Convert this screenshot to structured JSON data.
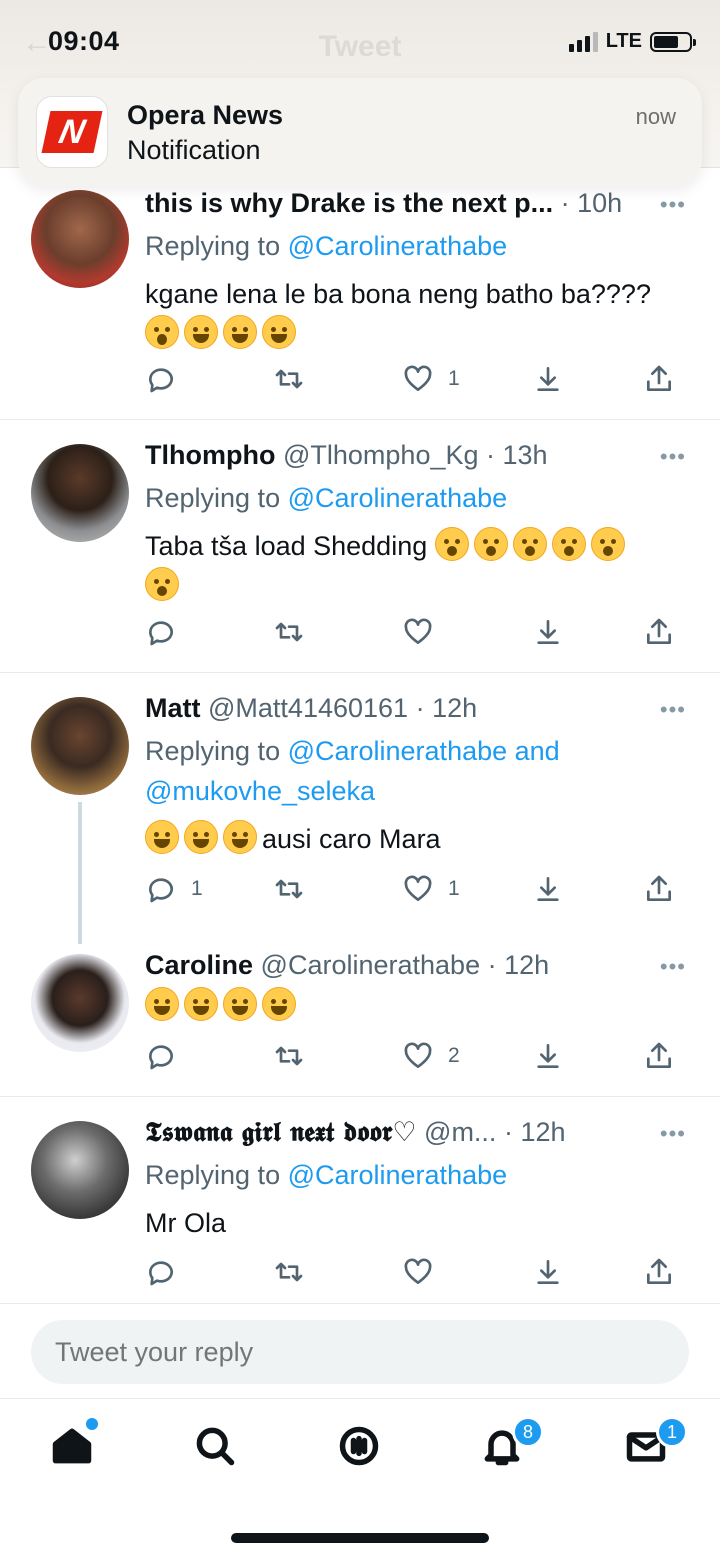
{
  "status_bar": {
    "time": "09:04",
    "network": "LTE"
  },
  "header": {
    "title": "Tweet"
  },
  "notification": {
    "app": "Opera News",
    "body": "Notification",
    "time": "now",
    "logo_letter": "N"
  },
  "tweets": [
    {
      "name": "this is why Drake is the next p...",
      "handle": "",
      "time": "10h",
      "reply_prefix": "Replying to ",
      "mentions": "@Carolinerathabe",
      "text": "kgane lena le ba bona neng batho ba????",
      "emojis": [
        "shock",
        "laugh",
        "laugh",
        "laugh"
      ],
      "replies": "",
      "likes": "1"
    },
    {
      "name": "Tlhompho",
      "handle": "@Tlhompho_Kg",
      "time": "13h",
      "reply_prefix": "Replying to ",
      "mentions": "@Carolinerathabe",
      "text": "Taba tša load Shedding",
      "emojis": [
        "yawn",
        "yawn",
        "yawn",
        "yawn",
        "yawn",
        "yawn"
      ],
      "replies": "",
      "likes": ""
    },
    {
      "name": "Matt",
      "handle": "@Matt41460161",
      "time": "12h",
      "reply_prefix": "Replying to ",
      "mentions": "@Carolinerathabe and @mukovhe_seleka",
      "text": "ausi caro Mara",
      "emojis": [
        "laugh",
        "laugh",
        "laugh"
      ],
      "replies": "1",
      "likes": "1"
    },
    {
      "name": "Caroline",
      "handle": "@Carolinerathabe",
      "time": "12h",
      "text": "",
      "emojis": [
        "laugh",
        "laugh",
        "laugh",
        "laugh"
      ],
      "replies": "",
      "likes": "2"
    },
    {
      "name": "𝕿𝖘𝖜𝖆𝖓𝖆 𝖌𝖎𝖗𝖑 𝖓𝖊𝖝𝖙 𝖉𝖔𝖔𝖗♡",
      "handle": "@m...",
      "time": "12h",
      "reply_prefix": "Replying to ",
      "mentions": "@Carolinerathabe",
      "text": "Mr Ola",
      "emojis": [],
      "replies": "",
      "likes": ""
    }
  ],
  "reply_box": {
    "placeholder": "Tweet your reply"
  },
  "tab_bar": {
    "notifications_badge": "8",
    "messages_badge": "1"
  },
  "icons": [
    "reply-icon",
    "retweet-icon",
    "like-icon",
    "download-icon",
    "share-icon",
    "more-icon",
    "home-icon",
    "search-icon",
    "spaces-icon",
    "bell-icon",
    "mail-icon"
  ],
  "colors": {
    "accent": "#1d9bf0",
    "text": "#0f1419",
    "muted": "#536471"
  }
}
